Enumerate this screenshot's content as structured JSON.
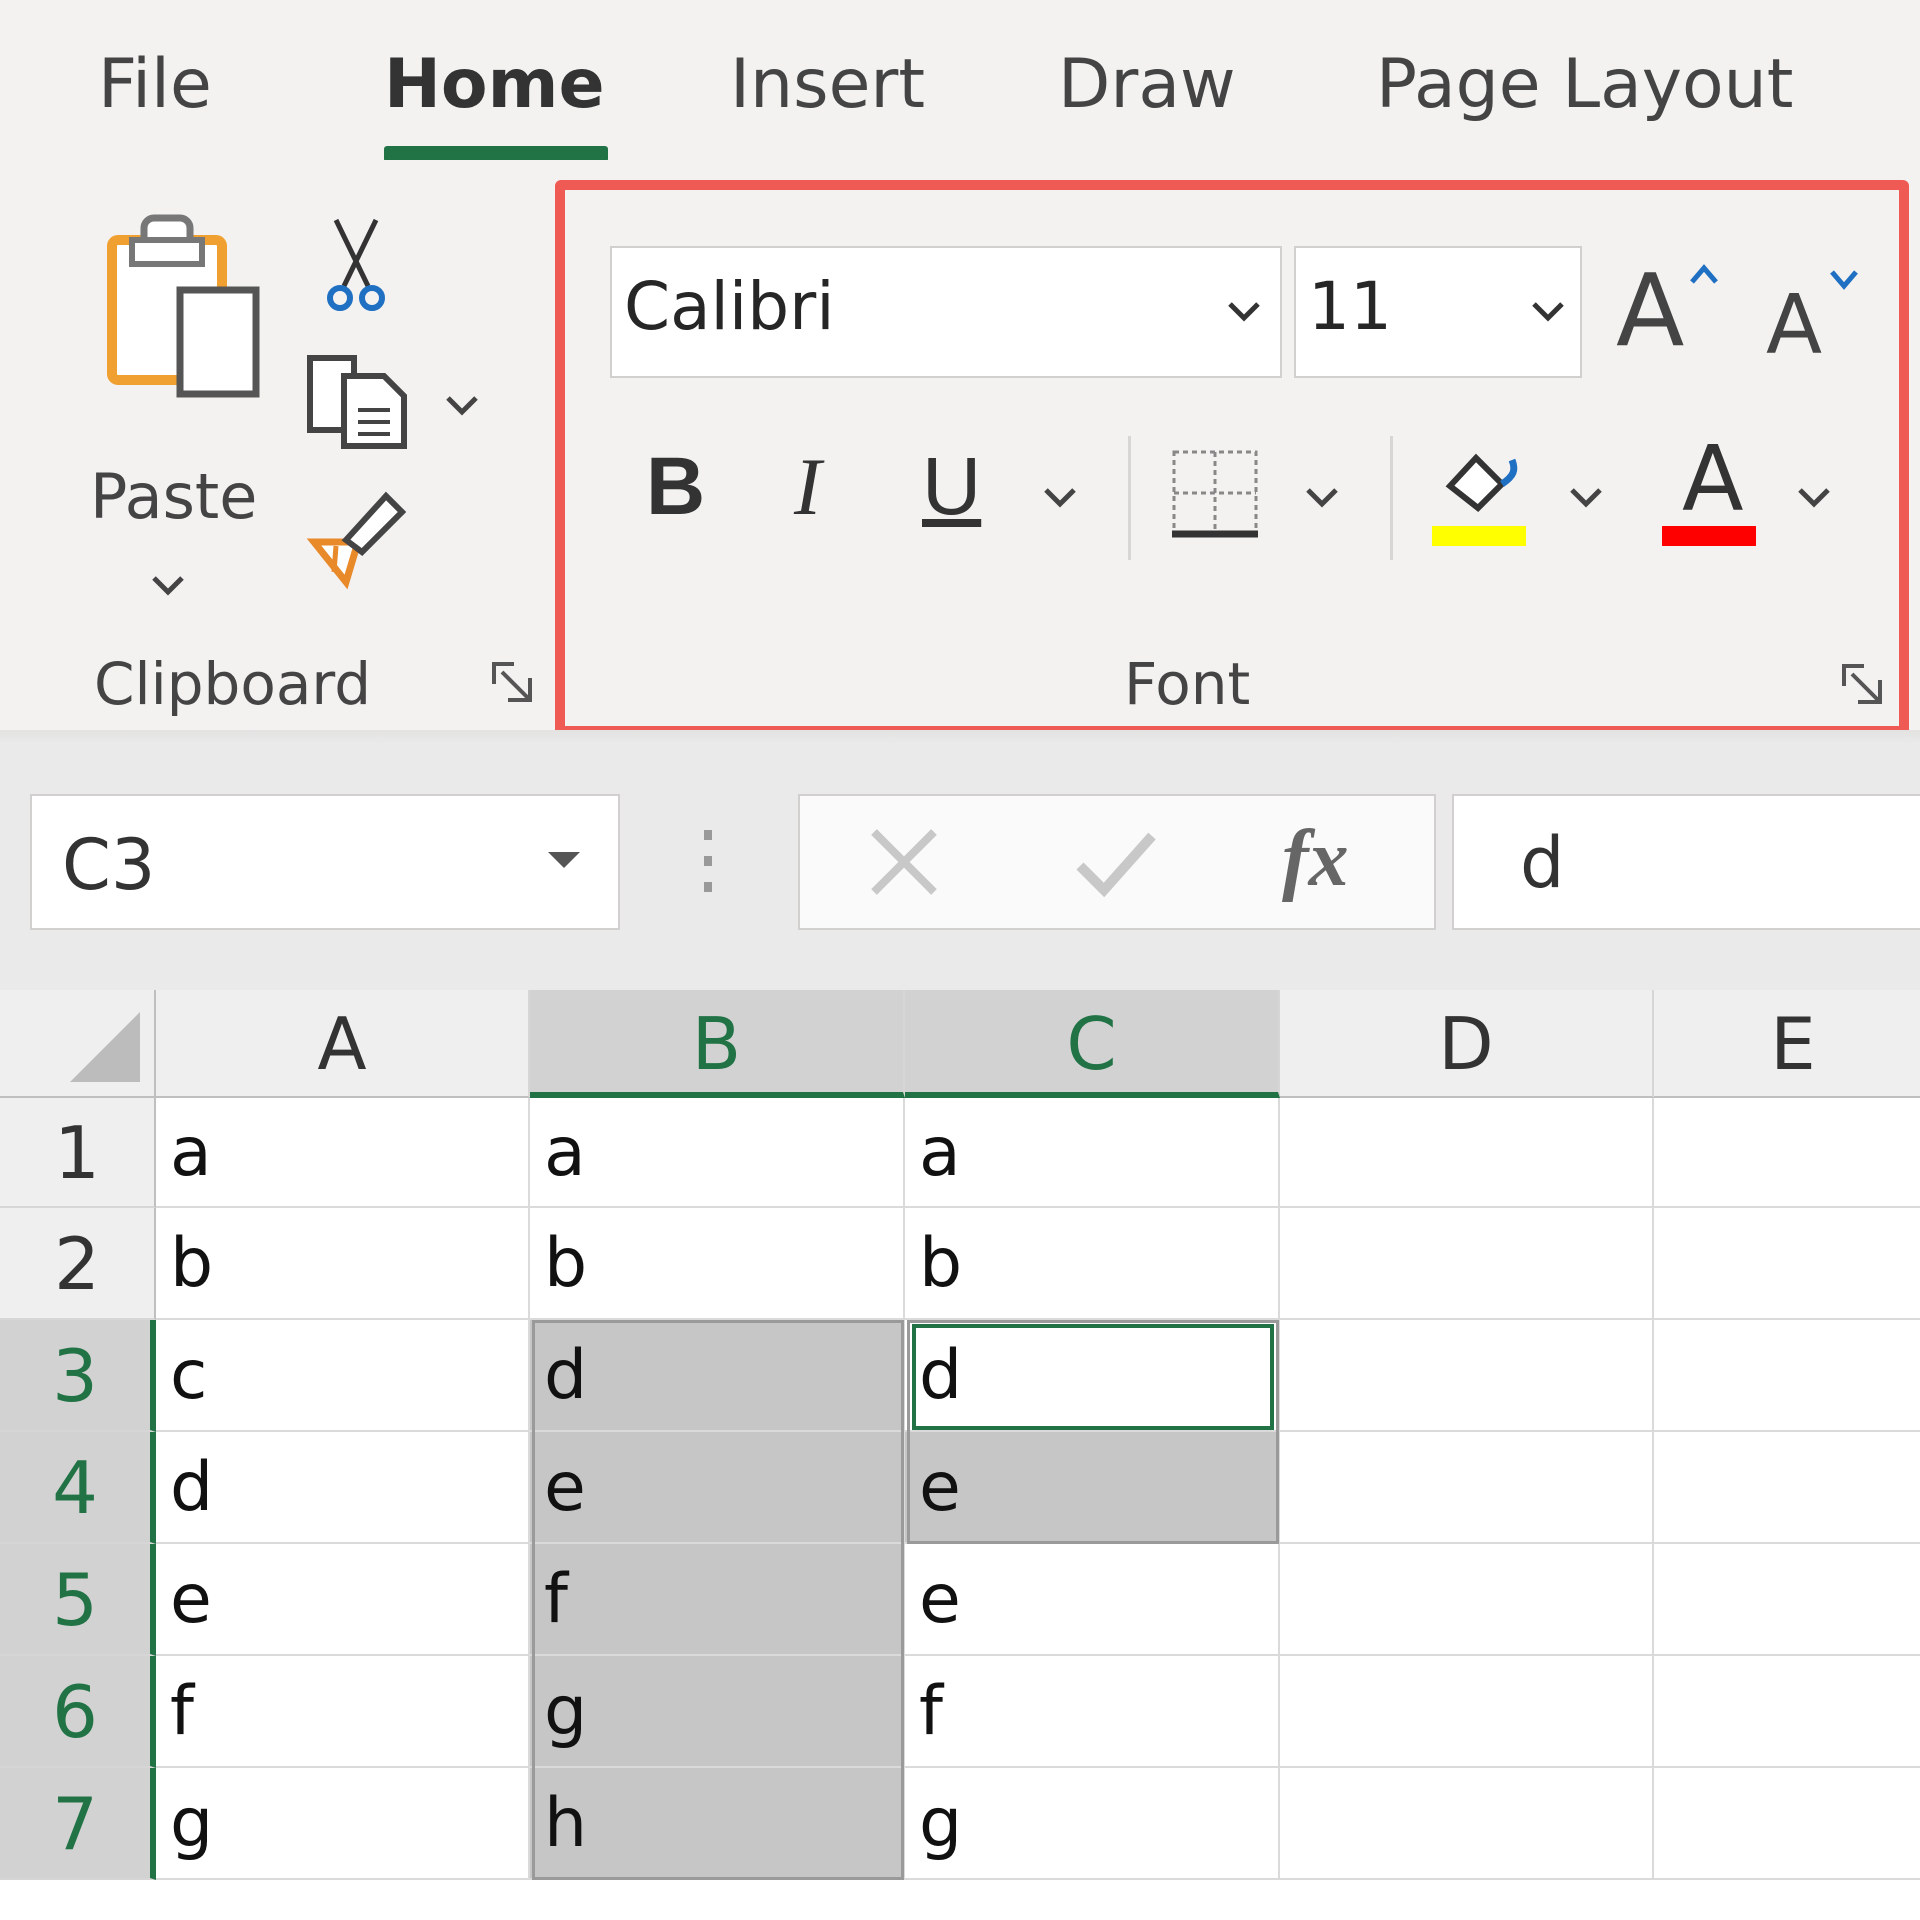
{
  "tabs": [
    "File",
    "Home",
    "Insert",
    "Draw",
    "Page Layout"
  ],
  "clipboard": {
    "paste_label": "Paste",
    "group_label": "Clipboard"
  },
  "font": {
    "group_label": "Font",
    "font_name": "Calibri",
    "font_size": "11",
    "bold": "B",
    "italic": "I",
    "underline": "U",
    "grow": "A",
    "shrink": "A",
    "font_color_glyph": "A",
    "highlight_color": "#ffff00",
    "font_color": "#ff0000"
  },
  "name_box": "C3",
  "formula_value": "d",
  "formula_icons": [
    "cancel-icon",
    "enter-icon",
    "fx-icon"
  ],
  "columns": [
    "A",
    "B",
    "C",
    "D",
    "E"
  ],
  "rows": [
    "1",
    "2",
    "3",
    "4",
    "5",
    "6",
    "7"
  ],
  "cells": {
    "A": [
      "a",
      "b",
      "c",
      "d",
      "e",
      "f",
      "g"
    ],
    "B": [
      "a",
      "b",
      "d",
      "e",
      "f",
      "g",
      "h"
    ],
    "C": [
      "a",
      "b",
      "d",
      "e",
      "e",
      "f",
      "g"
    ],
    "D": [
      "",
      "",
      "",
      "",
      "",
      "",
      ""
    ],
    "E": [
      "",
      "",
      "",
      "",
      "",
      "",
      ""
    ]
  },
  "colors": {
    "accent": "#217346",
    "highlight_border": "#f05a55",
    "selection_fill": "#c6c6c6"
  }
}
